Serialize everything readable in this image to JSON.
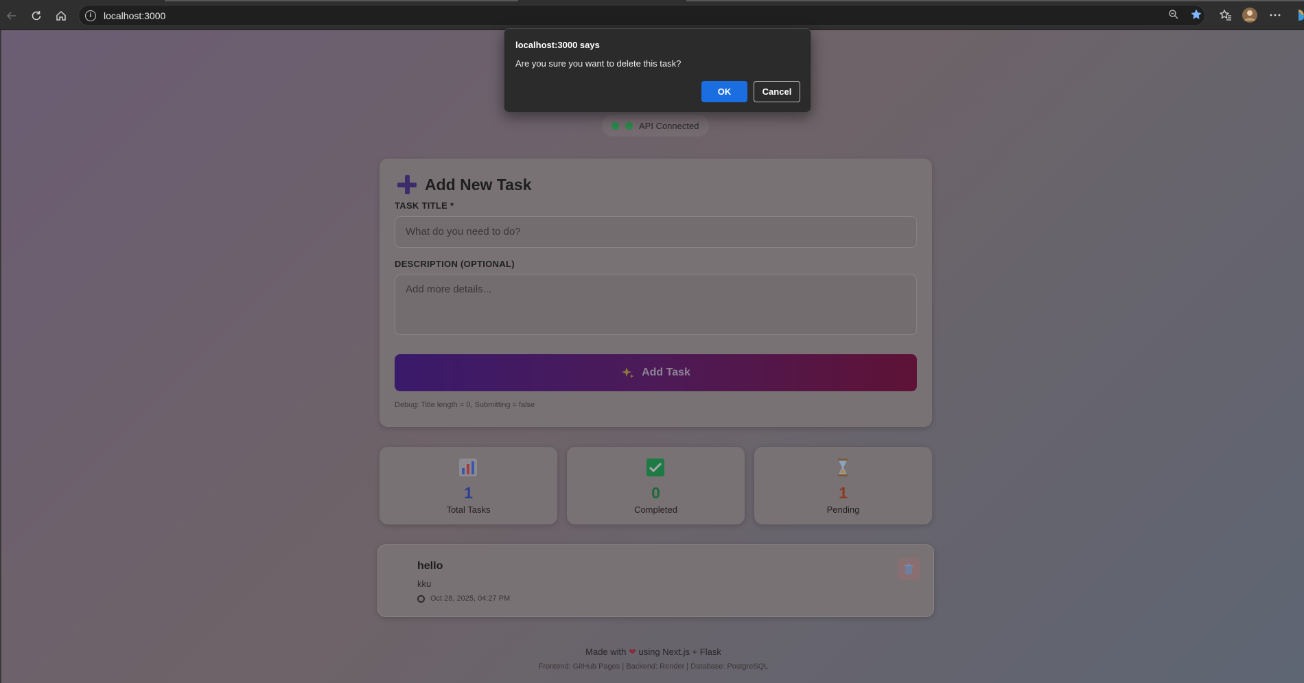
{
  "browser": {
    "url": "localhost:3000",
    "icons": [
      "back-icon",
      "refresh-icon",
      "home-icon",
      "info-icon",
      "zoom-icon",
      "star-icon",
      "favorites-icon",
      "profile-avatar",
      "more-icon"
    ]
  },
  "status": {
    "label": "API Connected",
    "color": "#2a8a4a"
  },
  "form": {
    "title": "Add New Task",
    "title_label": "TASK TITLE *",
    "title_placeholder": "What do you need to do?",
    "desc_label": "DESCRIPTION (OPTIONAL)",
    "desc_placeholder": "Add more details...",
    "submit_label": "Add Task",
    "submit_icon": "sparkles-icon",
    "debug": "Debug: Title length = 0, Submitting = false"
  },
  "stats": [
    {
      "value": "1",
      "label": "Total Tasks",
      "icon": "bar-chart-icon",
      "color": "#2a3f8f"
    },
    {
      "value": "0",
      "label": "Completed",
      "icon": "check-box-icon",
      "color": "#1d6a37"
    },
    {
      "value": "1",
      "label": "Pending",
      "icon": "hourglass-icon",
      "color": "#8a3a1a"
    }
  ],
  "tasks": [
    {
      "title": "hello",
      "description": "kku",
      "date": "Oct 28, 2025, 04:27 PM"
    }
  ],
  "footer": {
    "made_with_prefix": "Made with",
    "made_with_suffix": "using Next.js + Flask",
    "stack": "Frontend: GitHub Pages | Backend: Render | Database: PostgreSQL"
  },
  "dialog": {
    "title": "localhost:3000 says",
    "message": "Are you sure you want to delete this task?",
    "ok_label": "OK",
    "cancel_label": "Cancel"
  }
}
